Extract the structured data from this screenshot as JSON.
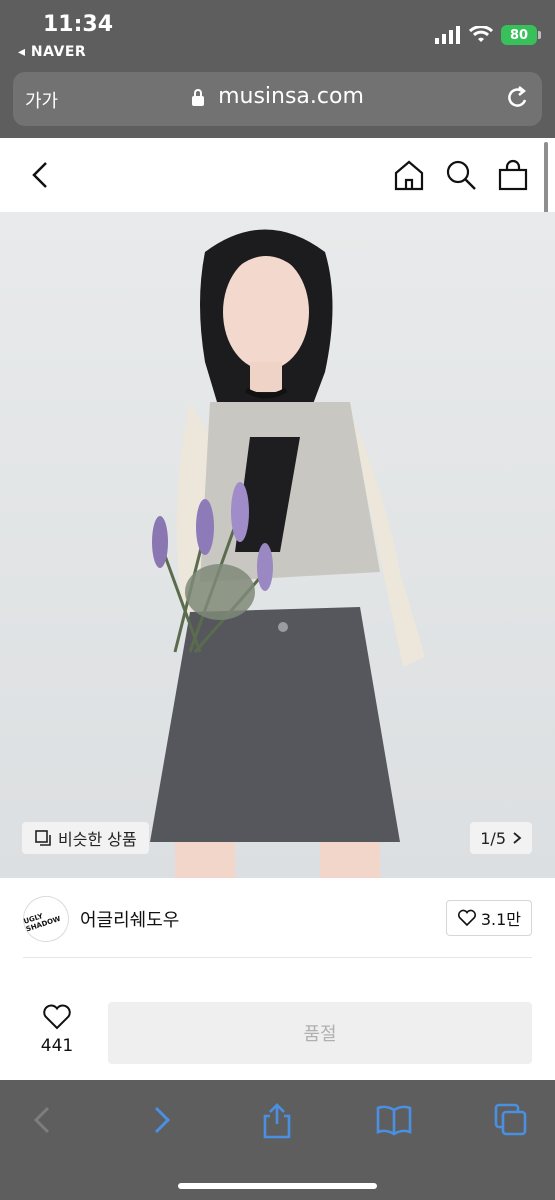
{
  "status_bar": {
    "time": "11:34",
    "back_app": "◂ NAVER",
    "battery": "80"
  },
  "address_bar": {
    "text_size_label": "가가",
    "url": "musinsa.com"
  },
  "gallery": {
    "similar_label": "비슷한 상품",
    "counter": "1/5"
  },
  "brand": {
    "logo_text": "UGLY SHADOW",
    "name": "어글리쉐도우",
    "like_count": "3.1만"
  },
  "purchase": {
    "wish_count": "441",
    "button_label": "품절"
  },
  "colors": {
    "chrome_bg": "#5e5e5e",
    "safari_blue": "#4a90e2",
    "battery_green": "#38c15a"
  }
}
